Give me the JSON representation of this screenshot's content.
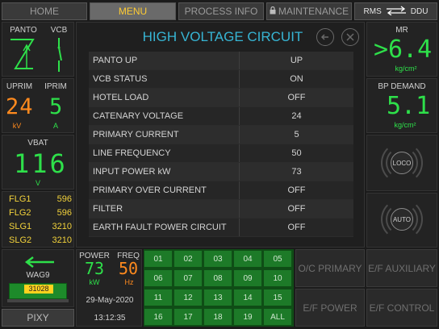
{
  "tabs": {
    "home": "HOME",
    "menu": "MENU",
    "process_info": "PROCESS INFO",
    "maintenance": "MAINTENANCE",
    "rms": "RMS",
    "ddu": "DDU"
  },
  "panto_vcb": {
    "panto_label": "PANTO",
    "vcb_label": "VCB"
  },
  "primary": {
    "uprim_label": "UPRIM",
    "uprim_value": "24",
    "uprim_unit": "kV",
    "iprim_label": "IPRIM",
    "iprim_value": "5",
    "iprim_unit": "A"
  },
  "vbat": {
    "label": "VBAT",
    "value": "116",
    "unit": "V"
  },
  "flags": [
    {
      "name": "FLG1",
      "value": "596"
    },
    {
      "name": "FLG2",
      "value": "596"
    },
    {
      "name": "SLG1",
      "value": "3210"
    },
    {
      "name": "SLG2",
      "value": "3210"
    }
  ],
  "loco": {
    "name": "WAG9",
    "number": "31028",
    "pixy": "PIXY"
  },
  "screen": {
    "title": "HIGH VOLTAGE CIRCUIT",
    "table": [
      {
        "name": "PANTO UP",
        "value": "UP"
      },
      {
        "name": "VCB STATUS",
        "value": "ON"
      },
      {
        "name": "HOTEL LOAD",
        "value": "OFF"
      },
      {
        "name": "CATENARY VOLTAGE",
        "value": "24"
      },
      {
        "name": "PRIMARY CURRENT",
        "value": "5"
      },
      {
        "name": "LINE FREQUENCY",
        "value": "50"
      },
      {
        "name": "INPUT POWER kW",
        "value": "73"
      },
      {
        "name": "PRIMARY OVER CURRENT",
        "value": "OFF"
      },
      {
        "name": "FILTER",
        "value": "OFF"
      },
      {
        "name": "EARTH FAULT POWER CIRCUIT",
        "value": "OFF"
      }
    ]
  },
  "mr": {
    "label": "MR",
    "value": ">6.4",
    "unit": "kg/cm²"
  },
  "bp": {
    "label": "BP DEMAND",
    "value": "5.1",
    "unit": "kg/cm²"
  },
  "right_buttons": {
    "loco": "LOCO",
    "auto": "AUTO"
  },
  "power_freq": {
    "power_label": "POWER",
    "power_value": "73",
    "power_unit": "kW",
    "freq_label": "FREQ",
    "freq_value": "50",
    "freq_unit": "Hz",
    "date": "29-May-2020",
    "time": "13:12:35"
  },
  "grid": [
    "01",
    "02",
    "03",
    "04",
    "05",
    "06",
    "07",
    "08",
    "09",
    "10",
    "11",
    "12",
    "13",
    "14",
    "15",
    "16",
    "17",
    "18",
    "19",
    "ALL"
  ],
  "fault_buttons": {
    "oc_primary": "O/C PRIMARY",
    "ef_auxiliary": "E/F AUXILIARY",
    "ef_power": "E/F POWER",
    "ef_control": "E/F CONTROL"
  }
}
